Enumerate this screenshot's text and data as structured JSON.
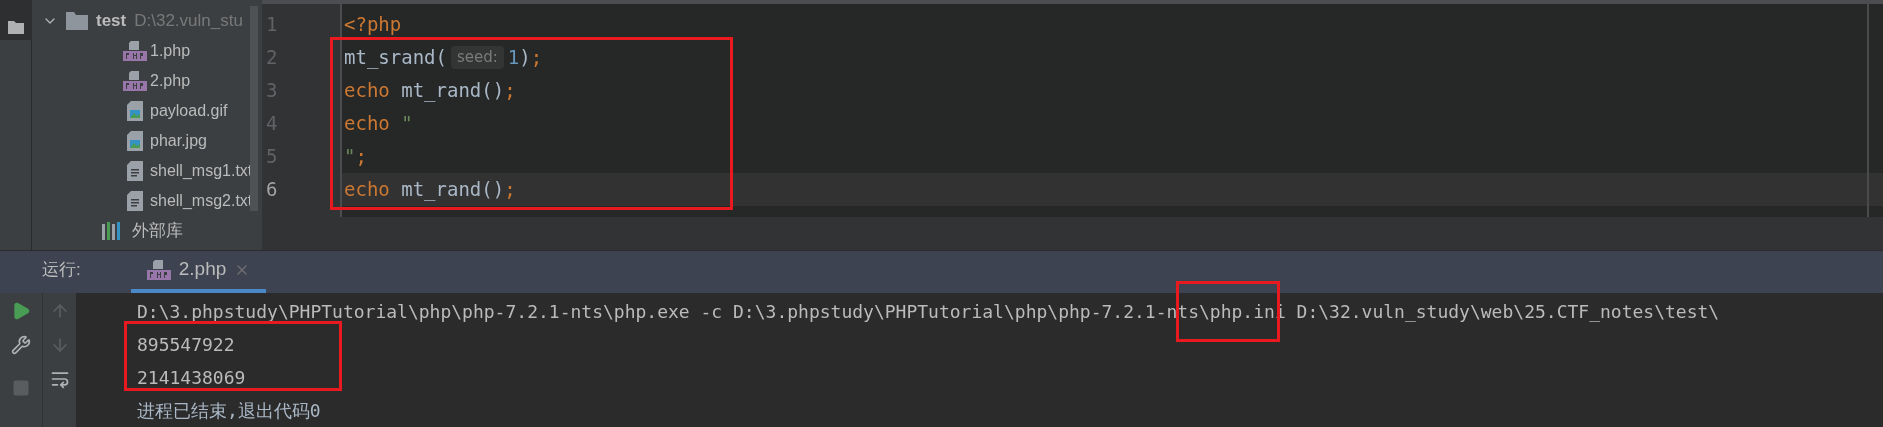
{
  "project_tree": {
    "root": {
      "name": "test",
      "path": "D:\\32.vuln_stu",
      "expanded": true,
      "children": [
        {
          "name": "1.php",
          "kind": "php"
        },
        {
          "name": "2.php",
          "kind": "php"
        },
        {
          "name": "payload.gif",
          "kind": "image"
        },
        {
          "name": "phar.jpg",
          "kind": "image"
        },
        {
          "name": "shell_msg1.txt",
          "kind": "text"
        },
        {
          "name": "shell_msg2.txt",
          "kind": "text"
        }
      ]
    },
    "external_libraries": "外部库"
  },
  "editor": {
    "lines": [
      {
        "number": "1",
        "selected": false,
        "tokens": [
          {
            "kind": "keyword",
            "text": "<?php"
          }
        ]
      },
      {
        "number": "2",
        "selected": false,
        "tokens": [
          {
            "kind": "plain",
            "text": "mt_srand("
          },
          {
            "kind": "hint",
            "text": "seed:"
          },
          {
            "kind": "number",
            "text": "1"
          },
          {
            "kind": "plain",
            "text": ")"
          },
          {
            "kind": "keyword",
            "text": ";"
          }
        ]
      },
      {
        "number": "3",
        "selected": false,
        "tokens": [
          {
            "kind": "keyword",
            "text": "echo"
          },
          {
            "kind": "plain",
            "text": " mt_rand()"
          },
          {
            "kind": "keyword",
            "text": ";"
          }
        ]
      },
      {
        "number": "4",
        "selected": false,
        "tokens": [
          {
            "kind": "keyword",
            "text": "echo"
          },
          {
            "kind": "string",
            "text": " \""
          }
        ]
      },
      {
        "number": "5",
        "selected": false,
        "tokens": [
          {
            "kind": "string",
            "text": "\""
          },
          {
            "kind": "keyword",
            "text": ";"
          }
        ]
      },
      {
        "number": "6",
        "selected": true,
        "tokens": [
          {
            "kind": "keyword",
            "text": "echo"
          },
          {
            "kind": "plain",
            "text": " mt_rand()"
          },
          {
            "kind": "keyword",
            "text": ";"
          }
        ]
      }
    ]
  },
  "run_panel": {
    "label": "运行:",
    "tabs": [
      {
        "label": "2.php",
        "selected": true
      }
    ],
    "output": [
      {
        "kind": "command",
        "text": "D:\\3.phpstudy\\PHPTutorial\\php\\php-7.2.1-nts\\php.exe -c D:\\3.phpstudy\\PHPTutorial\\php\\php-7.2.1-nts\\php.ini D:\\32.vuln_study\\web\\25.CTF_notes\\test\\"
      },
      {
        "kind": "stdout",
        "text": "895547922"
      },
      {
        "kind": "stdout",
        "text": "2141438069"
      },
      {
        "kind": "info",
        "text": "进程已结束,退出代码0"
      }
    ]
  }
}
